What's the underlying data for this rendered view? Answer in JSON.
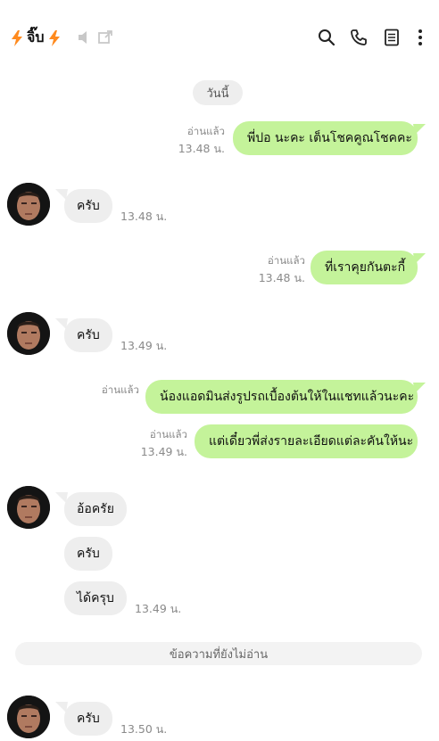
{
  "header": {
    "title": "จิ๊บ",
    "icons": [
      "bolt-icon",
      "speaker-muted-icon",
      "external-link-icon",
      "search-icon",
      "phone-icon",
      "notes-icon",
      "more-icon"
    ],
    "accent": "#ff8a1e"
  },
  "date_label": "วันนี้",
  "colors": {
    "outgoing_bubble": "#c4f39a",
    "incoming_bubble": "#eeeeee"
  },
  "messages": [
    {
      "dir": "out",
      "text": "พี่ปอ นะคะ เต็นโชคคูณโชคคะ",
      "read": "อ่านแล้ว",
      "time": "13.48 น."
    },
    {
      "dir": "in",
      "text": "ครับ",
      "time": "13.48 น."
    },
    {
      "dir": "out",
      "text": "ที่เราคุยกันตะกี้",
      "read": "อ่านแล้ว",
      "time": "13.48 น."
    },
    {
      "dir": "in",
      "text": "ครับ",
      "time": "13.49 น."
    },
    {
      "dir": "out",
      "text": "น้องแอดมินส่งรูปรถเบื้องต้นให้ในแชทแล้วนะคะ",
      "read": "อ่านแล้ว",
      "time": ""
    },
    {
      "dir": "out",
      "text": "แต่เดี๋ยวพี่ส่งรายละเอียดแต่ละคันให้นะ",
      "read": "อ่านแล้ว",
      "time": "13.49 น."
    },
    {
      "dir": "in",
      "text": "อ้อครัย",
      "time": ""
    },
    {
      "dir": "in",
      "text": "ครับ",
      "time": ""
    },
    {
      "dir": "in",
      "text": "ได้ครุบ",
      "time": "13.49 น."
    },
    {
      "dir": "in",
      "text": "ครับ",
      "time": "13.50 น."
    }
  ],
  "unread_label": "ข้อความที่ยังไม่อ่าน"
}
